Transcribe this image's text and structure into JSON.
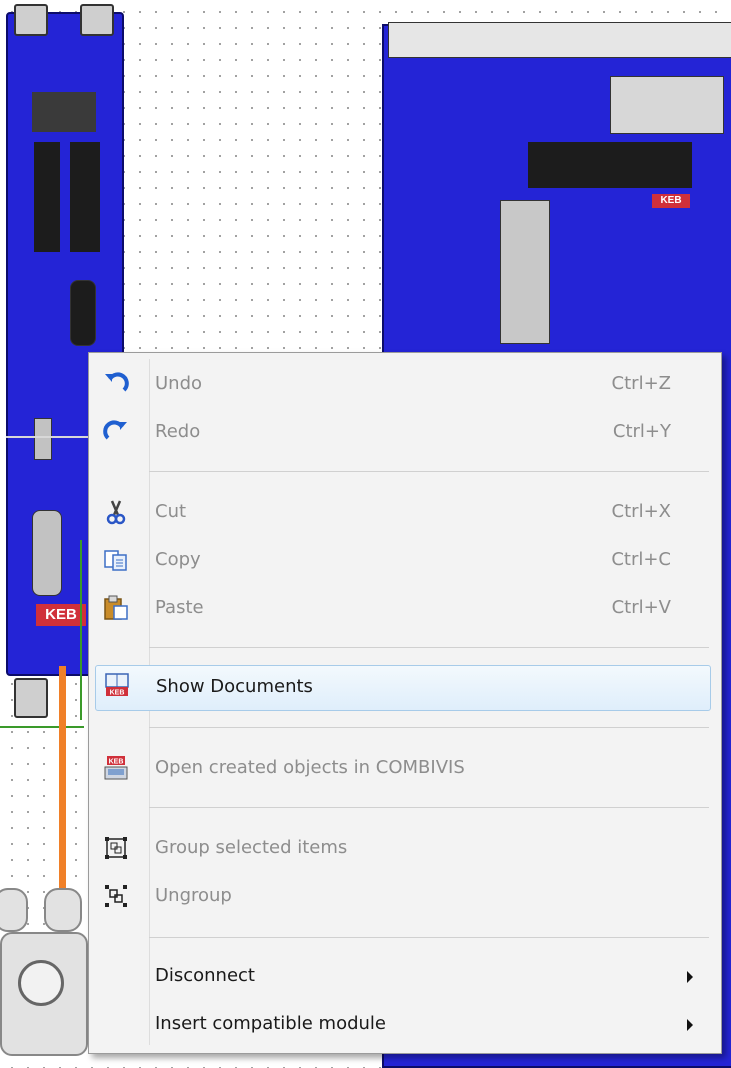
{
  "canvas": {
    "left_module": {
      "logo_text": "KEB"
    },
    "right_module": {
      "logo_text": "KEB"
    }
  },
  "context_menu": {
    "items": [
      {
        "label": "Undo",
        "shortcut": "Ctrl+Z",
        "icon": "undo-icon",
        "enabled": false
      },
      {
        "label": "Redo",
        "shortcut": "Ctrl+Y",
        "icon": "redo-icon",
        "enabled": false
      },
      {
        "label": "Cut",
        "shortcut": "Ctrl+X",
        "icon": "scissors-icon",
        "enabled": false
      },
      {
        "label": "Copy",
        "shortcut": "Ctrl+C",
        "icon": "copy-icon",
        "enabled": false
      },
      {
        "label": "Paste",
        "shortcut": "Ctrl+V",
        "icon": "paste-icon",
        "enabled": false
      },
      {
        "label": "Show Documents",
        "shortcut": "",
        "icon": "book-keb-icon",
        "enabled": true,
        "highlighted": true
      },
      {
        "label": "Open created objects in COMBIVIS",
        "shortcut": "",
        "icon": "combivis-icon",
        "enabled": false
      },
      {
        "label": "Group selected items",
        "shortcut": "",
        "icon": "group-icon",
        "enabled": false
      },
      {
        "label": "Ungroup",
        "shortcut": "",
        "icon": "ungroup-icon",
        "enabled": false
      },
      {
        "label": "Disconnect",
        "shortcut": "",
        "icon": "",
        "enabled": true,
        "submenu": true
      },
      {
        "label": "Insert compatible module",
        "shortcut": "",
        "icon": "",
        "enabled": true,
        "submenu": true
      }
    ]
  },
  "colors": {
    "module_blue": "#2424d6",
    "menu_bg": "#f3f3f3",
    "highlight_border": "#a7cbe9",
    "disabled_text": "#8d8d8d",
    "keb_red": "#d0303a"
  }
}
